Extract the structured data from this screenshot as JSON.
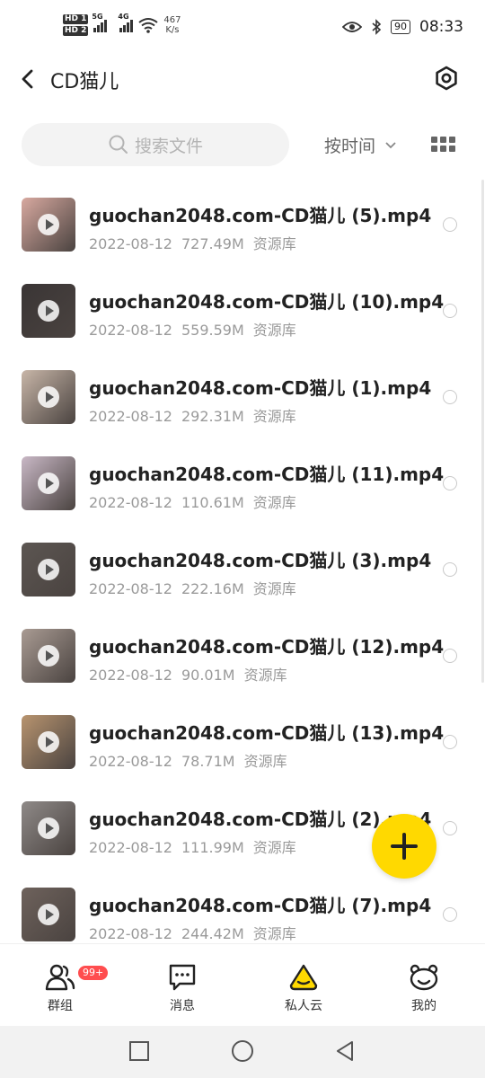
{
  "status_bar": {
    "sim1": "HD 1",
    "sim2": "HD 2",
    "net1": "5G",
    "net2": "4G",
    "speed_value": "467",
    "speed_unit": "K/s",
    "battery": "90",
    "time": "08:33"
  },
  "header": {
    "title": "CD猫儿"
  },
  "toolbar": {
    "search_placeholder": "搜索文件",
    "sort_label": "按时间"
  },
  "files": [
    {
      "name": "guochan2048.com-CD猫儿 (5).mp4",
      "date": "2022-08-12",
      "size": "727.49M",
      "source": "资源库",
      "thumb_color": "#d8a9a0"
    },
    {
      "name": "guochan2048.com-CD猫儿 (10).mp4",
      "date": "2022-08-12",
      "size": "559.59M",
      "source": "资源库",
      "thumb_color": "#3a3535"
    },
    {
      "name": "guochan2048.com-CD猫儿 (1).mp4",
      "date": "2022-08-12",
      "size": "292.31M",
      "source": "资源库",
      "thumb_color": "#c8b6a8"
    },
    {
      "name": "guochan2048.com-CD猫儿 (11).mp4",
      "date": "2022-08-12",
      "size": "110.61M",
      "source": "资源库",
      "thumb_color": "#c9b8c6"
    },
    {
      "name": "guochan2048.com-CD猫儿 (3).mp4",
      "date": "2022-08-12",
      "size": "222.16M",
      "source": "资源库",
      "thumb_color": "#5c5652"
    },
    {
      "name": "guochan2048.com-CD猫儿 (12).mp4",
      "date": "2022-08-12",
      "size": "90.01M",
      "source": "资源库",
      "thumb_color": "#a99b93"
    },
    {
      "name": "guochan2048.com-CD猫儿 (13).mp4",
      "date": "2022-08-12",
      "size": "78.71M",
      "source": "资源库",
      "thumb_color": "#b8946f"
    },
    {
      "name": "guochan2048.com-CD猫儿 (2).mp4",
      "date": "2022-08-12",
      "size": "111.99M",
      "source": "资源库",
      "thumb_color": "#8f8a88"
    },
    {
      "name": "guochan2048.com-CD猫儿 (7).mp4",
      "date": "2022-08-12",
      "size": "244.42M",
      "source": "资源库",
      "thumb_color": "#6e625c"
    }
  ],
  "tabs": {
    "groups": {
      "label": "群组",
      "badge": "99+"
    },
    "messages": {
      "label": "消息"
    },
    "private_cloud": {
      "label": "私人云"
    },
    "mine": {
      "label": "我的"
    }
  },
  "colors": {
    "accent": "#ffd900",
    "badge": "#ff4d4f"
  }
}
